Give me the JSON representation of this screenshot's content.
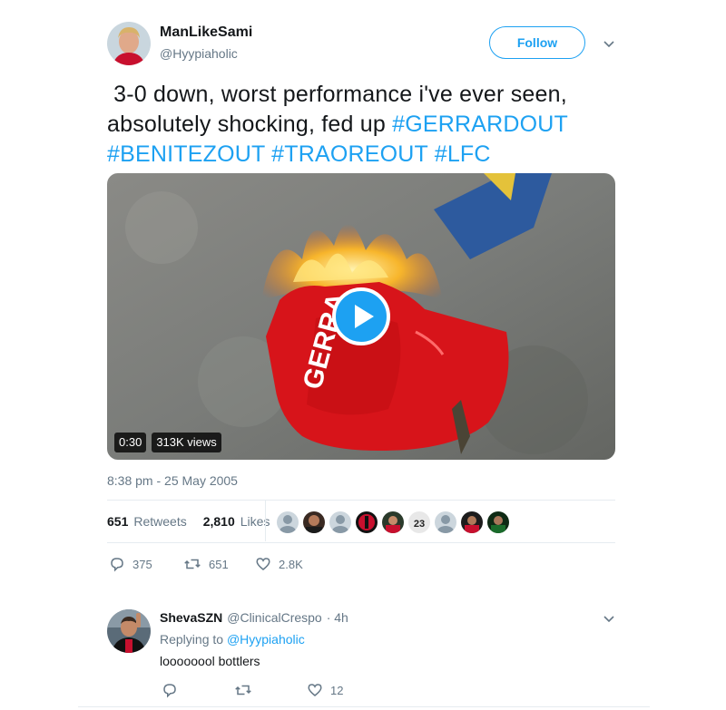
{
  "tweet": {
    "display_name": "ManLikeSami",
    "handle": "@Hyypiaholic",
    "follow_label": "Follow",
    "text_plain_1": "3-0 down, worst performance i've ever seen,",
    "text_plain_2": "absolutely shocking, fed up ",
    "hashtags": [
      "#GERRARDOUT",
      "#BENITEZOUT",
      "#TRAOREOUT",
      "#LFC"
    ],
    "video": {
      "duration": "0:30",
      "views": "313K views",
      "shirt_text": "GERRA"
    },
    "timestamp": "8:38 pm - 25 May 2005",
    "retweets_count": "651",
    "retweets_label": "Retweets",
    "likes_count": "2,810",
    "likes_label": "Likes",
    "shirt_number": "23",
    "actions": {
      "replies": "375",
      "retweets": "651",
      "likes": "2.8K"
    }
  },
  "reply": {
    "display_name": "ShevaSZN",
    "handle": "@ClinicalCrespo",
    "time": "· 4h",
    "replying_prefix": "Replying to",
    "replying_to": "@Hyypiaholic",
    "text": "loooooool bottlers",
    "actions": {
      "replies": "",
      "retweets": "",
      "likes": "12"
    }
  },
  "colors": {
    "accent": "#1da1f2",
    "muted": "#657786",
    "text": "#14171a",
    "border": "#e6ecf0"
  },
  "icons": [
    "chevron-down-icon",
    "play-icon",
    "reply-icon",
    "retweet-icon",
    "heart-icon"
  ]
}
